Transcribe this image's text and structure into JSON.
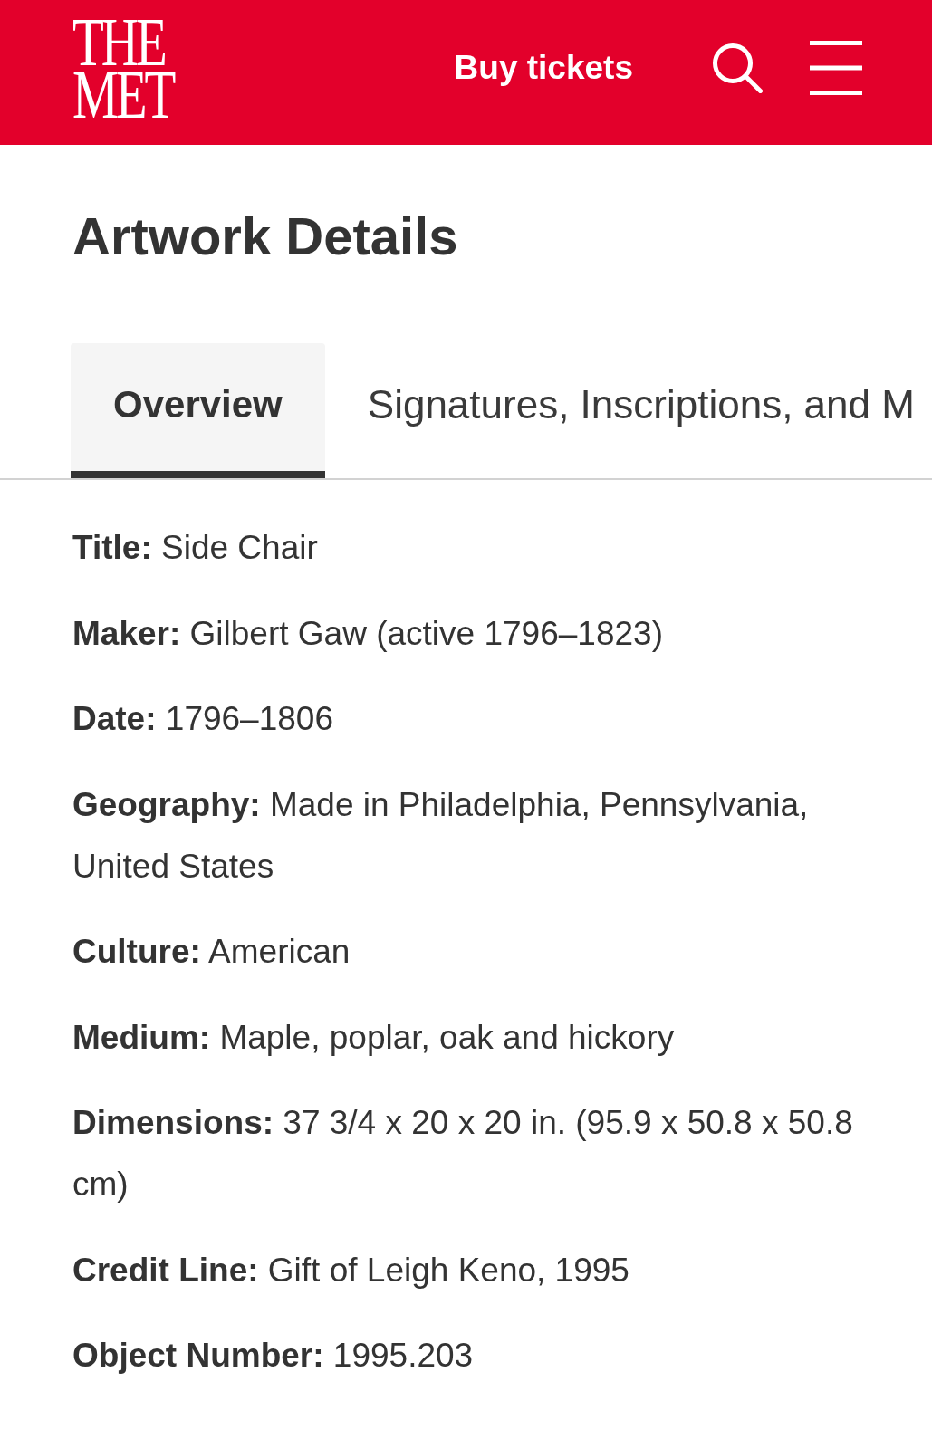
{
  "header": {
    "logo": [
      "THE",
      "MET"
    ],
    "buy_tickets": "Buy tickets"
  },
  "page_title": "Artwork Details",
  "tabs": [
    {
      "label": "Overview",
      "selected": true
    },
    {
      "label": "Signatures, Inscriptions, and M",
      "selected": false
    }
  ],
  "details": [
    {
      "label": "Title:",
      "value": "Side Chair"
    },
    {
      "label": "Maker:",
      "value": "Gilbert Gaw (active 1796–1823)"
    },
    {
      "label": "Date:",
      "value": "1796–1806"
    },
    {
      "label": "Geography:",
      "value": "Made in Philadelphia, Pennsylvania, United States"
    },
    {
      "label": "Culture:",
      "value": "American"
    },
    {
      "label": "Medium:",
      "value": "Maple, poplar, oak and hickory"
    },
    {
      "label": "Dimensions:",
      "value": "37 3/4 x 20 x 20 in. (95.9 x 50.8 x 50.8 cm)"
    },
    {
      "label": "Credit Line:",
      "value": "Gift of Leigh Keno, 1995"
    },
    {
      "label": "Object Number:",
      "value": "1995.203"
    }
  ]
}
